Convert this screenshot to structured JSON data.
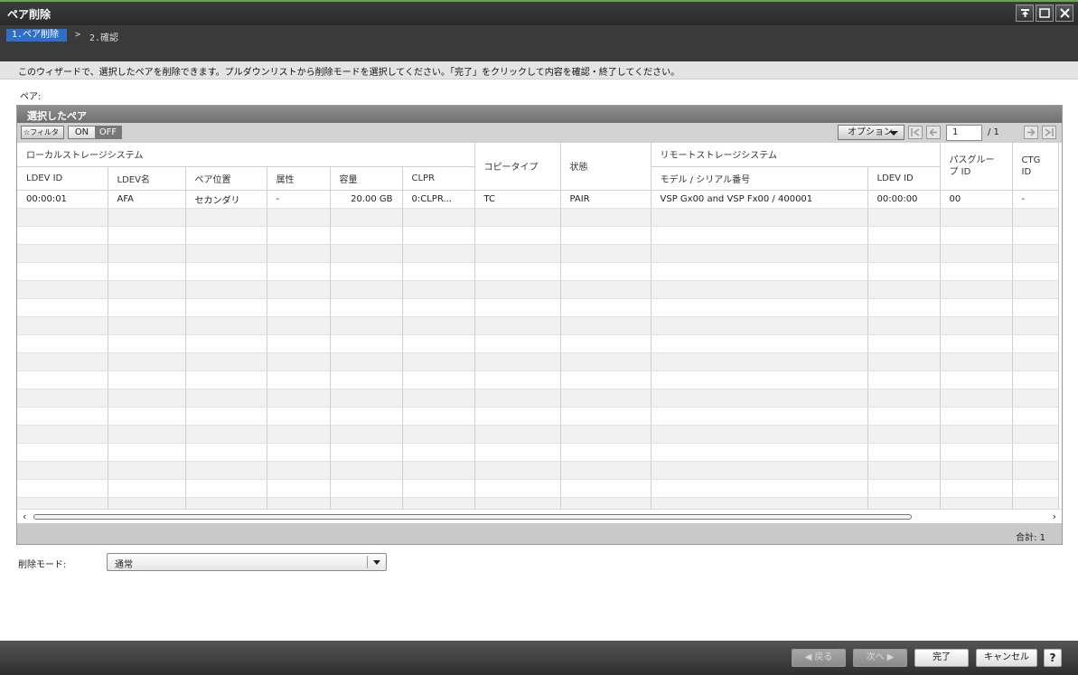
{
  "window": {
    "title": "ペア削除"
  },
  "steps": {
    "active": "1.ペア削除",
    "separator": ">",
    "next": "2.確認"
  },
  "description": "このウィザードで、選択したペアを削除できます。プルダウンリストから削除モードを選択してください。「完了」をクリックして内容を確認・終了してください。",
  "pair_label": "ペア:",
  "panel": {
    "title": "選択したペア",
    "filter_label": "☆フィルタ",
    "toggle_on": "ON",
    "toggle_off": "OFF",
    "options_label": "オプション",
    "page_current": "1",
    "page_total": "/ 1",
    "total": "合計:  1"
  },
  "table": {
    "group_local": "ローカルストレージシステム",
    "group_remote": "リモートストレージシステム",
    "col_copy_type": "コピータイプ",
    "col_status": "状態",
    "col_path_group": "パスグループ ID",
    "col_ctg": "CTG ID",
    "cols_local": [
      "LDEV ID",
      "LDEV名",
      "ペア位置",
      "属性",
      "容量",
      "CLPR"
    ],
    "col_model_serial": "モデル / シリアル番号",
    "col_remote_ldev": "LDEV ID",
    "rows": [
      {
        "ldev_id": "00:00:01",
        "ldev_name": "AFA",
        "pair_pos": "セカンダリ",
        "attr": "-",
        "capacity": "20.00 GB",
        "clpr": "0:CLPR...",
        "copy_type": "TC",
        "status": "PAIR",
        "model_serial": "VSP Gx00 and VSP Fx00 / 400001",
        "remote_ldev": "00:00:00",
        "path_group": "00",
        "ctg": "-"
      }
    ]
  },
  "delete_mode": {
    "label": "削除モード:",
    "value": "通常"
  },
  "buttons": {
    "back": "◀ 戻る",
    "next": "次へ ▶",
    "finish": "完了",
    "cancel": "キャンセル",
    "help": "?"
  }
}
